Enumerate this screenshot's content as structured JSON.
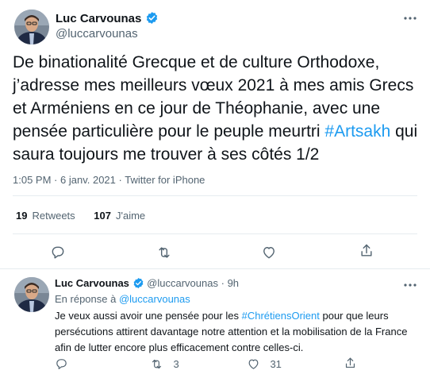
{
  "tweet": {
    "author_name": "Luc Carvounas",
    "author_handle": "@luccarvounas",
    "text_parts": [
      "De binationalité Grecque et de culture Orthodoxe, j’adresse mes meilleurs vœux 2021 à mes amis Grecs et Arméniens en ce jour de Théophanie, avec une pensée particulière pour le peuple meurtri ",
      "#Artsakh",
      " qui saura toujours me trouver à ses côtés 1/2"
    ],
    "time": "1:05 PM",
    "date": "6 janv. 2021",
    "separator": "·",
    "source": "Twitter for iPhone",
    "retweets_count": "19",
    "retweets_label": "Retweets",
    "likes_count": "107",
    "likes_label": "J'aime"
  },
  "reply": {
    "author_name": "Luc Carvounas",
    "author_handle": "@luccarvounas",
    "dot": "·",
    "time_ago": "9h",
    "in_reply_prefix": "En réponse à",
    "in_reply_handle": "@luccarvounas",
    "text_parts": [
      "Je veux aussi avoir une pensée pour les ",
      "#ChrétiensOrient",
      " pour que leurs persécutions attirent davantage notre attention et la mobilisation de la France afin de lutter encore plus efficacement contre celles-ci."
    ],
    "retweet_count": "3",
    "like_count": "31"
  },
  "colors": {
    "text": "#0f1419",
    "secondary": "#536471",
    "accent": "#1d9bf0",
    "divider": "#e6ecf0"
  },
  "icons": [
    "verified-badge-icon",
    "more-icon",
    "reply-icon",
    "retweet-icon",
    "like-icon",
    "share-icon"
  ]
}
